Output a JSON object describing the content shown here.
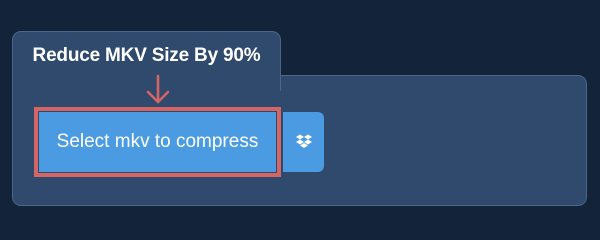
{
  "header": {
    "title": "Reduce MKV Size By 90%"
  },
  "upload": {
    "select_label": "Select mkv to compress",
    "dropbox_icon": "dropbox-icon",
    "highlight_color": "#d56464"
  },
  "colors": {
    "background": "#13233a",
    "panel": "#2f4a6c",
    "button": "#4a9be2",
    "annotation": "#d56464"
  }
}
